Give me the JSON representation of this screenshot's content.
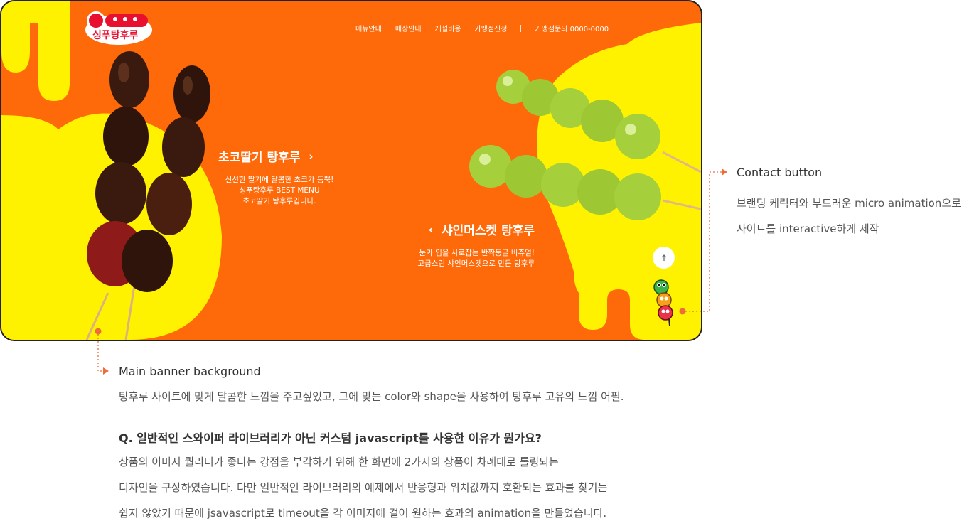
{
  "site": {
    "logo_text": "싱푸탕후루",
    "nav": [
      "메뉴안내",
      "매장안내",
      "개설비용",
      "가맹점신청"
    ],
    "contact": "가맹점문의 0000-0000"
  },
  "products": {
    "left": {
      "title": "초코딸기 탕후루",
      "desc": [
        "신선한 딸기에 달콤한 초코가 듬뿍!",
        "싱푸탕후루 BEST MENU",
        "초코딸기 탕후루입니다."
      ]
    },
    "right": {
      "title": "샤인머스켓 탕후루",
      "desc": [
        "눈과 입을 사로잡는 반짝둥글 비쥬얼!",
        "고급스런 샤인머스켓으로 만든 탕후루"
      ]
    }
  },
  "icons": {
    "next": "chevron-right-icon",
    "prev": "chevron-left-icon",
    "top": "arrow-up-icon",
    "mascot": "mascot-icon"
  },
  "colors": {
    "orange": "#fe6a0a",
    "yellow": "#fff200",
    "accent": "#ee6c3a"
  },
  "annotations": {
    "contact": {
      "title": "Contact button",
      "lines": [
        "브랜딩 케릭터와 부드러운 micro animation으로",
        "사이트를 interactive하게 제작"
      ]
    },
    "banner": {
      "title": "Main banner background",
      "desc": "탕후루 사이트에 맞게 달콤한 느낌을 주고싶었고, 그에 맞는 color와 shape을 사용하여 탕후루 고유의 느낌 어필."
    },
    "qa": {
      "title": "Q. 일반적인 스와이퍼 라이브러리가 아닌 커스텀 javascript를 사용한 이유가 뭔가요?",
      "lines": [
        "상품의 이미지 퀄리티가 좋다는 강점을 부각하기 위해 한 화면에 2가지의 상품이 차례대로 롤링되는",
        "디자인을 구상하였습니다. 다만 일반적인 라이브러리의 예제에서 반응형과 위치값까지 호환되는 효과를 찾기는",
        "쉽지 않았기 때문에 jsavascript로 timeout을 각 이미지에 걸어 원하는 효과의 animation을 만들었습니다."
      ]
    }
  }
}
